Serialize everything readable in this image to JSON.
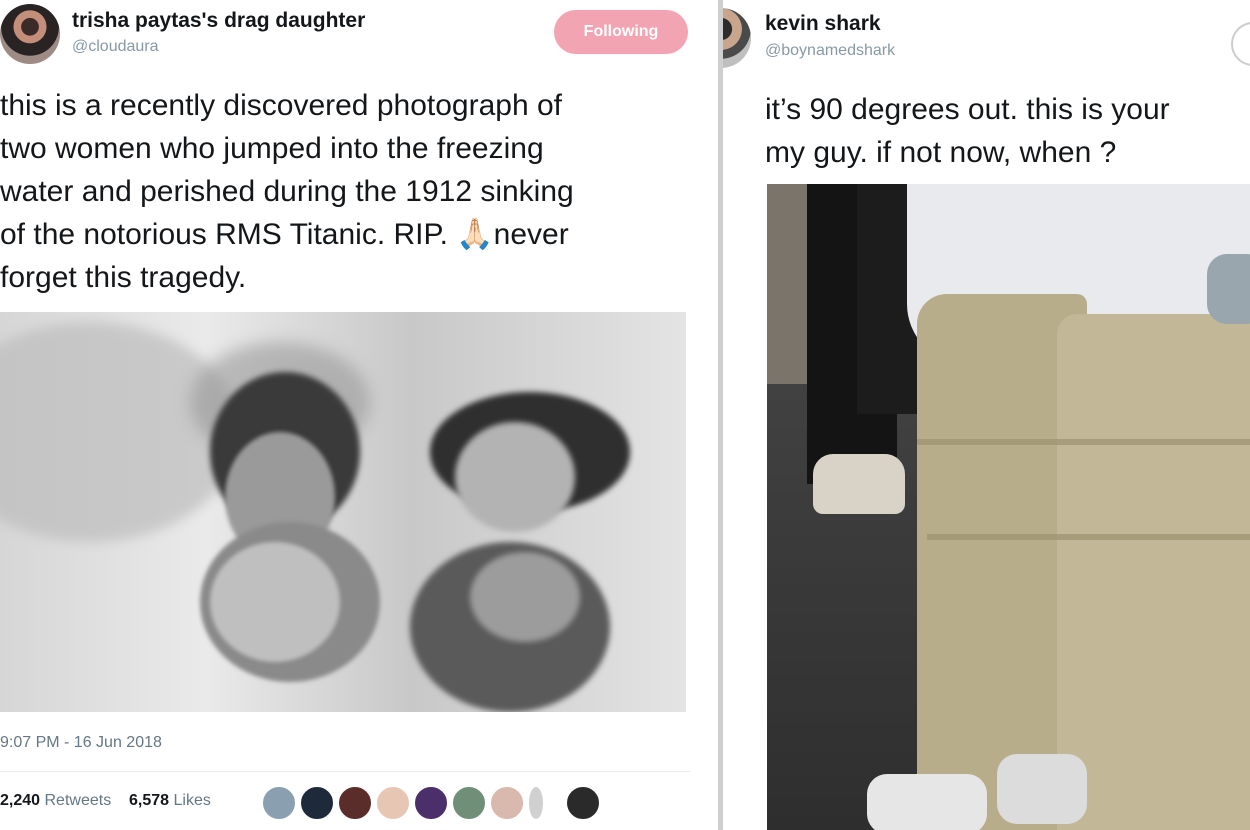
{
  "left_tweet": {
    "display_name": "trisha paytas's drag daughter",
    "handle": "@cloudaura",
    "follow_button": "Following",
    "text": "this is a recently discovered photograph of\ntwo women who jumped into the freezing\nwater and perished during the 1912 sinking\nof the notorious RMS Titanic. RIP. 🙏🏻never\nforget this tragedy.",
    "timestamp": "9:07 PM - 16 Jun 2018",
    "retweets_count": "2,240",
    "retweets_label": "Retweets",
    "likes_count": "6,578",
    "likes_label": "Likes"
  },
  "right_tweet": {
    "display_name": "kevin shark",
    "handle": "@boynamedshark",
    "text": "it’s 90 degrees out. this is your\nmy guy. if not now, when ?"
  },
  "colors": {
    "follow_button_bg": "#f3a4b3",
    "handle_gray": "#8899a6",
    "text_dark": "#14171a",
    "divider": "#cfcfcf"
  },
  "icons": {
    "left_avatar": "user-avatar-icon",
    "right_avatar": "user-avatar-icon",
    "liker_avatars": "liker-avatar-icon",
    "right_follow": "follow-circle-icon"
  }
}
